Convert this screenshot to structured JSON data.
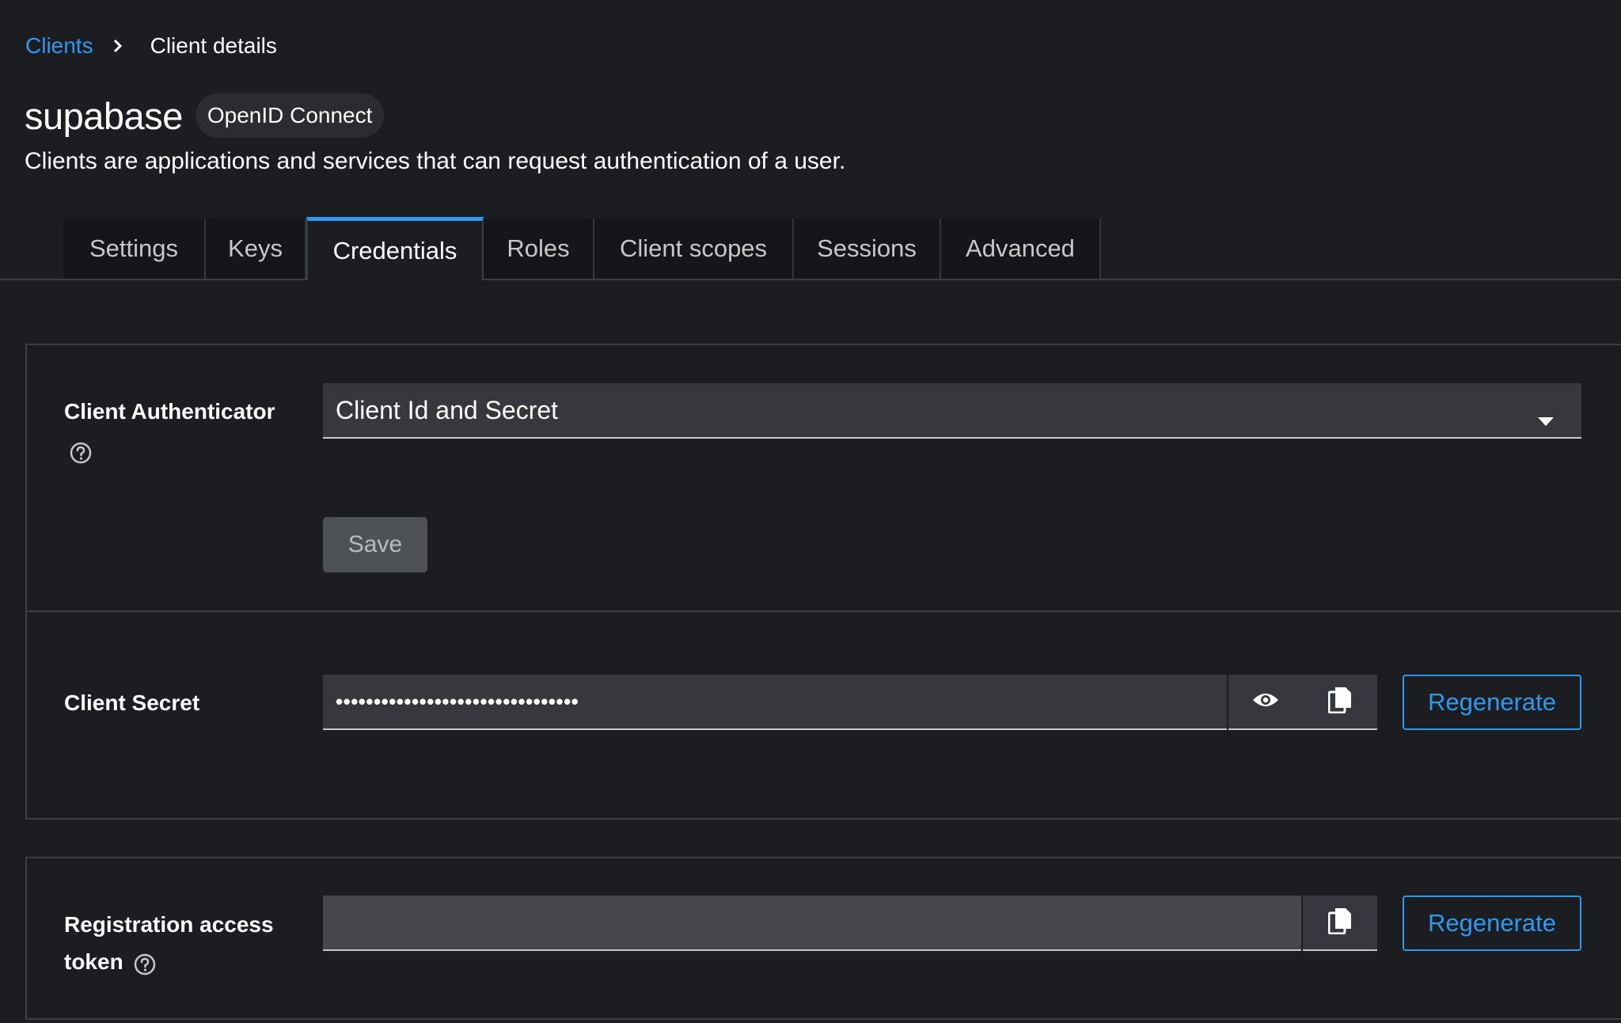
{
  "breadcrumb": {
    "parent": "Clients",
    "current": "Client details"
  },
  "header": {
    "title": "supabase",
    "protocol_badge": "OpenID Connect",
    "description": "Clients are applications and services that can request authentication of a user."
  },
  "tabs": [
    {
      "label": "Settings",
      "active": false
    },
    {
      "label": "Keys",
      "active": false
    },
    {
      "label": "Credentials",
      "active": true
    },
    {
      "label": "Roles",
      "active": false
    },
    {
      "label": "Client scopes",
      "active": false
    },
    {
      "label": "Sessions",
      "active": false
    },
    {
      "label": "Advanced",
      "active": false
    }
  ],
  "authenticator": {
    "label": "Client Authenticator",
    "selected": "Client Id and Secret",
    "save_label": "Save"
  },
  "client_secret": {
    "label": "Client Secret",
    "masked_value": "••••••••••••••••••••••••••••••••",
    "regenerate_label": "Regenerate"
  },
  "registration_token": {
    "label_line1": "Registration access",
    "label_line2": "token",
    "value": "",
    "regenerate_label": "Regenerate"
  },
  "colors": {
    "background": "#1b1d21",
    "accent": "#2b9af3",
    "input_bg": "#36383d",
    "border": "#3c3f42"
  }
}
